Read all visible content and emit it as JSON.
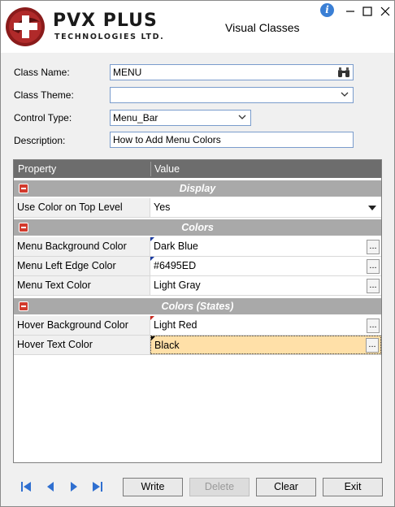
{
  "window": {
    "title": "Visual Classes",
    "brand_name": "PVX PLUS",
    "brand_sub": "TECHNOLOGIES LTD."
  },
  "form": {
    "class_name_label": "Class Name:",
    "class_name_value": "MENU",
    "class_theme_label": "Class Theme:",
    "class_theme_value": "",
    "control_type_label": "Control Type:",
    "control_type_value": "Menu_Bar",
    "description_label": "Description:",
    "description_value": "How to Add Menu Colors"
  },
  "grid": {
    "col_property": "Property",
    "col_value": "Value",
    "categories": [
      {
        "title": "Display"
      },
      {
        "title": "Colors"
      },
      {
        "title": "Colors (States)"
      }
    ],
    "rows": [
      {
        "name": "Use Color on Top Level",
        "value": "Yes"
      },
      {
        "name": "Menu Background Color",
        "value": "Dark Blue"
      },
      {
        "name": "Menu Left Edge Color",
        "value": "#6495ED"
      },
      {
        "name": "Menu Text Color",
        "value": "Light Gray"
      },
      {
        "name": "Hover Background Color",
        "value": "Light Red"
      },
      {
        "name": "Hover Text Color",
        "value": "Black"
      }
    ],
    "ellipsis": "..."
  },
  "buttons": {
    "write": "Write",
    "delete": "Delete",
    "clear": "Clear",
    "exit": "Exit"
  },
  "colors": {
    "header_bg": "#6d6d6d",
    "category_bg": "#a9a9a9",
    "selected_bg": "#ffe0a8",
    "accent_blue": "#3a7fd5"
  }
}
